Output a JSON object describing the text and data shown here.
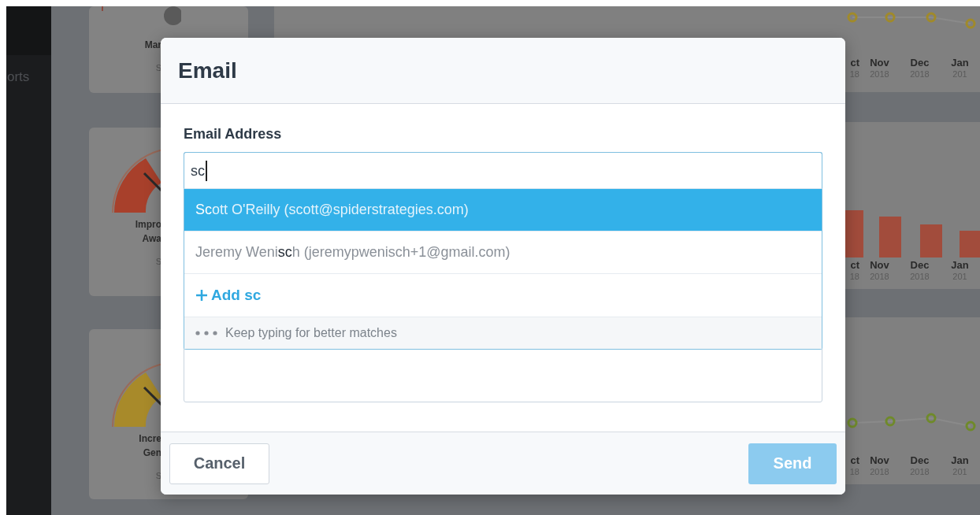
{
  "sidebar": {
    "items": [
      {
        "label": "orts"
      }
    ]
  },
  "gauges": [
    {
      "labels": [
        "Mar"
      ],
      "sub": "S",
      "color": "#5a5a5a",
      "kind": "knob"
    },
    {
      "labels": [
        "Impro",
        "Awa"
      ],
      "sub": "S",
      "color": "#a8402b",
      "kind": "dial"
    },
    {
      "labels": [
        "Incre",
        "Gen"
      ],
      "sub": "S",
      "color": "#a88a2a",
      "kind": "dial"
    }
  ],
  "charts": [
    {
      "kind": "line",
      "color": "#a08a2a",
      "axis": [
        {
          "month": "ct",
          "year": "18"
        },
        {
          "month": "Nov",
          "year": "2018"
        },
        {
          "month": "Dec",
          "year": "2018"
        },
        {
          "month": "Jan",
          "year": "201"
        }
      ]
    },
    {
      "kind": "bar",
      "color": "#a24c3c",
      "axis": [
        {
          "month": "ct",
          "year": "18"
        },
        {
          "month": "Nov",
          "year": "2018"
        },
        {
          "month": "Dec",
          "year": "2018"
        },
        {
          "month": "Jan",
          "year": "201"
        }
      ]
    },
    {
      "kind": "line",
      "color": "#6f8a2a",
      "axis": [
        {
          "month": "ct",
          "year": "18"
        },
        {
          "month": "Nov",
          "year": "2018"
        },
        {
          "month": "Dec",
          "year": "2018"
        },
        {
          "month": "Jan",
          "year": "201"
        }
      ]
    }
  ],
  "dialog": {
    "title": "Email",
    "field": {
      "label": "Email Address",
      "value": "sc"
    },
    "suggestions": [
      {
        "text": "**Sc**ott O'Reilly (scott@spiderstrategies.com)",
        "selected": true
      },
      {
        "text": "Jeremy Weni**sc**h (jeremypwenisch+1@gmail.com)",
        "selected": false
      }
    ],
    "add_option": {
      "label": "Add sc"
    },
    "hint": "Keep typing for better matches",
    "buttons": [
      {
        "label": "Cancel",
        "kind": "secondary",
        "disabled": false
      },
      {
        "label": "Send",
        "kind": "primary",
        "disabled": true
      }
    ]
  }
}
